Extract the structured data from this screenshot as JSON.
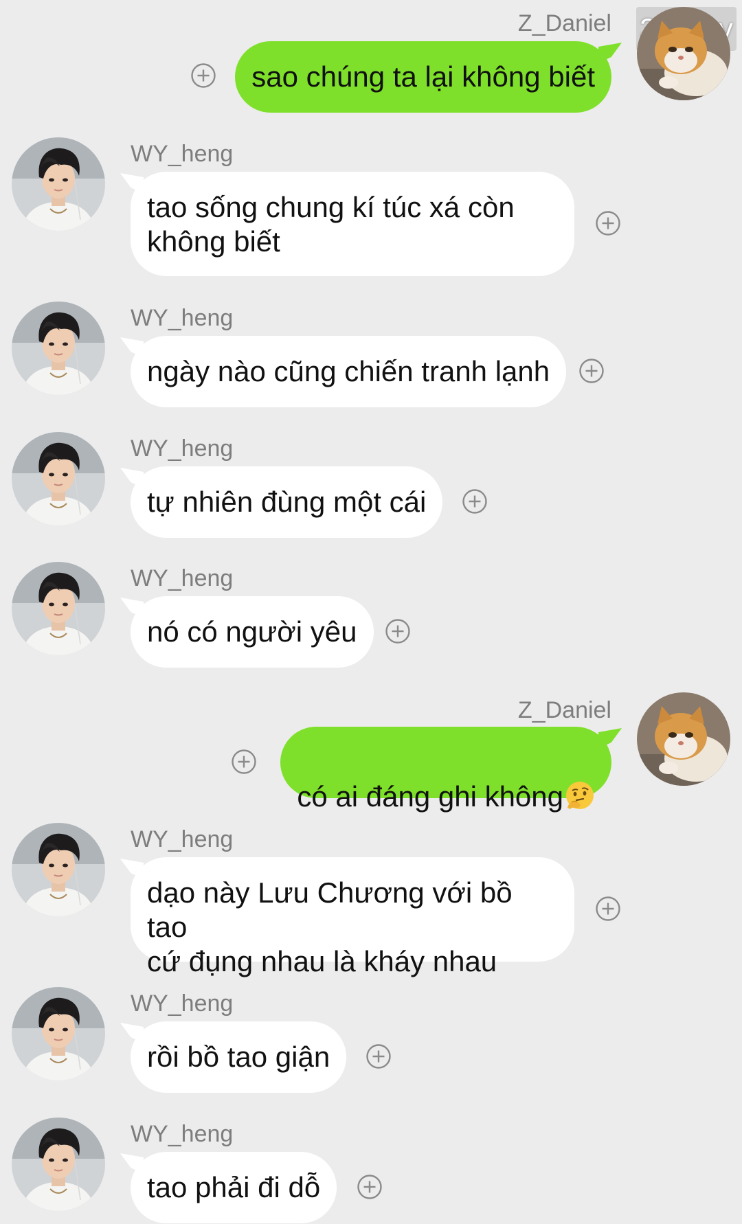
{
  "watermark": "330 joy",
  "users": {
    "me": "Z_Daniel",
    "other": "WY_heng"
  },
  "messages": [
    {
      "sender": "Z_Daniel",
      "text": "sao chúng ta lại không biết"
    },
    {
      "sender": "WY_heng",
      "text": "tao sống chung kí túc xá còn\nkhông biết"
    },
    {
      "sender": "WY_heng",
      "text": "ngày nào cũng chiến tranh lạnh"
    },
    {
      "sender": "WY_heng",
      "text": "tự nhiên đùng một cái"
    },
    {
      "sender": "WY_heng",
      "text": "nó có người yêu"
    },
    {
      "sender": "Z_Daniel",
      "text": "có ai đáng ghi không",
      "emoji": "thinking-face"
    },
    {
      "sender": "WY_heng",
      "text": "dạo này Lưu Chương với bồ tao\ncứ đụng nhau là kháy nhau"
    },
    {
      "sender": "WY_heng",
      "text": "rồi bồ tao giận"
    },
    {
      "sender": "WY_heng",
      "text": "tao phải đi dỗ"
    }
  ],
  "colors": {
    "background": "#ececec",
    "my_bubble": "#7ee02a",
    "their_bubble": "#ffffff",
    "name_text": "#7d7d7d"
  }
}
